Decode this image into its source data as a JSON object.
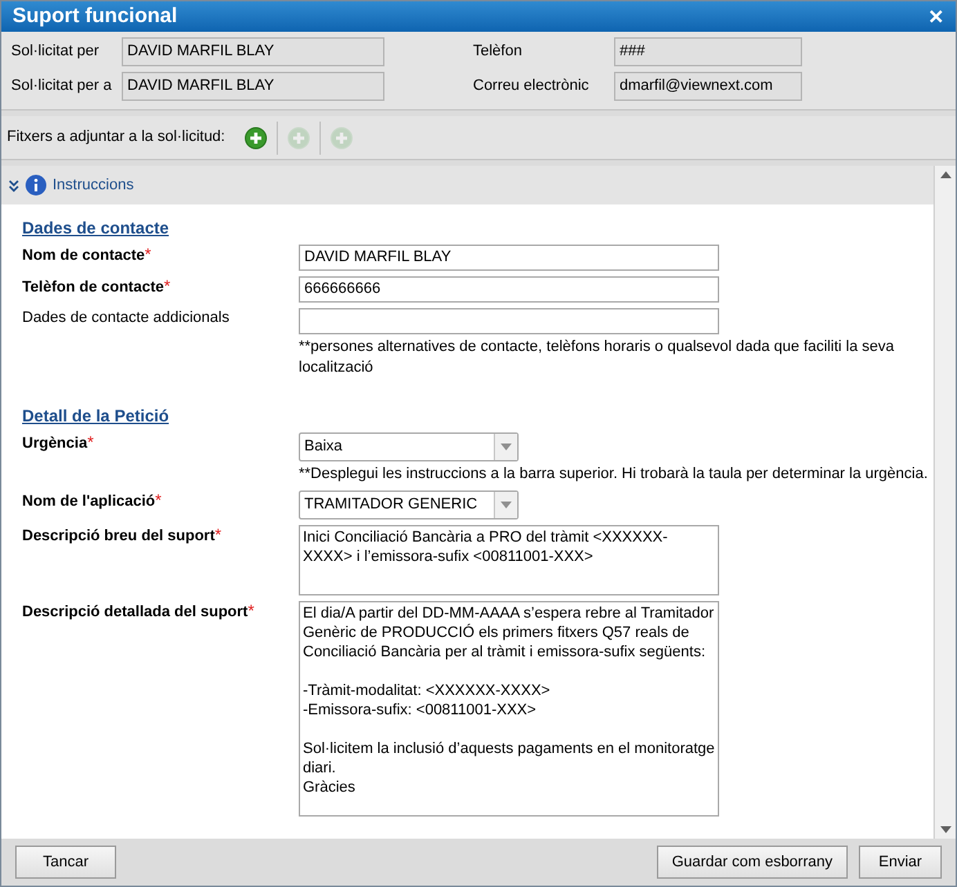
{
  "window": {
    "title": "Suport funcional",
    "close": "✕"
  },
  "header": [
    {
      "label": "Sol·licitat per",
      "value": "DAVID MARFIL BLAY"
    },
    {
      "label": "Telèfon",
      "value": "###"
    },
    {
      "label": "Sol·licitat per a",
      "value": "DAVID MARFIL BLAY"
    },
    {
      "label": "Correu electrònic",
      "value": "dmarfil@viewnext.com"
    }
  ],
  "required_mark": "*",
  "attachments": {
    "label": "Fitxers a adjuntar a la sol·licitud:",
    "buttons": [
      {
        "disabled": false
      },
      {
        "disabled": true
      },
      {
        "disabled": true
      }
    ]
  },
  "instructions": {
    "label": "Instruccions",
    "expanded": false
  },
  "sections": [
    {
      "title": "Dades de contacte",
      "fields": [
        {
          "kind": "input",
          "label": "Nom de contacte",
          "required": true,
          "value": "DAVID MARFIL BLAY"
        },
        {
          "kind": "input",
          "label": "Telèfon de contacte",
          "required": true,
          "value": "666666666"
        },
        {
          "kind": "input",
          "label": "Dades de contacte addicionals",
          "required": false,
          "note": "**persones alternatives de contacte, telèfons horaris o qualsevol dada que faciliti la seva localització"
        }
      ]
    },
    {
      "title": "Detall de la Petició",
      "fields": [
        {
          "kind": "select",
          "label": "Urgència",
          "required": true,
          "value": "Baixa",
          "note": "**Desplegui les instruccions a la barra superior. Hi trobarà la taula per determinar la urgència."
        },
        {
          "kind": "select",
          "label": "Nom de l'aplicació",
          "required": true,
          "value": "TRAMITADOR GENERIC"
        },
        {
          "kind": "textarea",
          "label": "Descripció breu del suport",
          "required": true,
          "value": "Inici Conciliació Bancària a PRO del tràmit <XXXXXX-XXXX> i l’emissora-sufix <00811001-XXX>"
        },
        {
          "kind": "textarea_tall",
          "label": "Descripció detallada del suport",
          "required": true,
          "value": "El dia/A partir del DD-MM-AAAA s’espera rebre al Tramitador Genèric de PRODUCCIÓ els primers fitxers Q57 reals de Conciliació Bancària per al tràmit i emissora-sufix següents:\n\n-Tràmit-modalitat: <XXXXXX-XXXX>\n-Emissora-sufix: <00811001-XXX>\n\nSol·licitem la inclusió d’aquests pagaments en el monitoratge diari.\nGràcies"
        }
      ]
    }
  ],
  "footer": {
    "left": [
      "Tancar"
    ],
    "right": [
      "Guardar com esborrany",
      "Enviar"
    ]
  }
}
